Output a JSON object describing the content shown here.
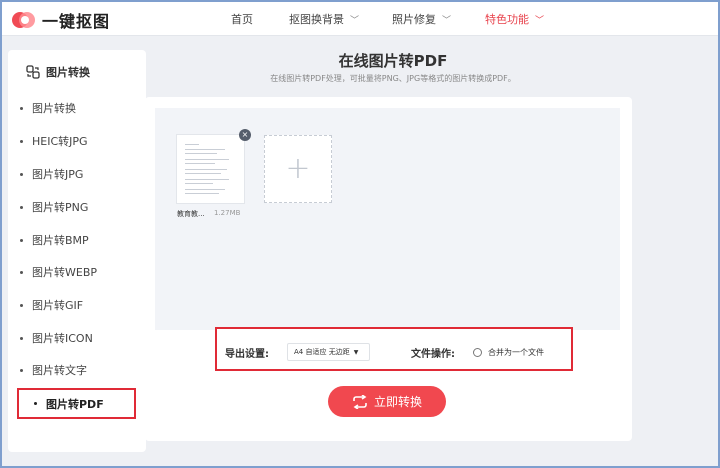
{
  "app": {
    "logo_text": "一键抠图"
  },
  "nav": [
    {
      "label": "首页",
      "has_dropdown": false
    },
    {
      "label": "抠图换背景",
      "has_dropdown": true
    },
    {
      "label": "照片修复",
      "has_dropdown": true
    },
    {
      "label": "特色功能",
      "has_dropdown": true,
      "active": true
    }
  ],
  "sidebar": {
    "heading": "图片转换",
    "items": [
      {
        "label": "图片转换"
      },
      {
        "label": "HEIC转JPG"
      },
      {
        "label": "图片转JPG"
      },
      {
        "label": "图片转PNG"
      },
      {
        "label": "图片转BMP"
      },
      {
        "label": "图片转WEBP"
      },
      {
        "label": "图片转GIF"
      },
      {
        "label": "图片转ICON"
      },
      {
        "label": "图片转文字"
      },
      {
        "label": "图片转PDF",
        "active": true
      }
    ]
  },
  "main": {
    "title": "在线图片转PDF",
    "subtitle": "在线图片转PDF处理，可批量将PNG、JPG等格式的图片转换成PDF。",
    "file": {
      "name": "教育教...",
      "size": "1.27MB"
    },
    "add_symbol": "+",
    "close_symbol": "×",
    "export_label": "导出设置:",
    "export_value": "A4 自适应 无边距",
    "file_op_label": "文件操作:",
    "merge_option": "合并为一个文件",
    "convert_button": "立即转换"
  },
  "colors": {
    "accent": "#f1484f",
    "highlight_border": "#e02a36",
    "active_nav": "#e8424c"
  },
  "icons": [
    "logo-icon",
    "chevron-down-icon",
    "image-convert-icon",
    "close-icon",
    "plus-icon",
    "dropdown-arrow-icon",
    "radio-icon",
    "convert-icon"
  ]
}
